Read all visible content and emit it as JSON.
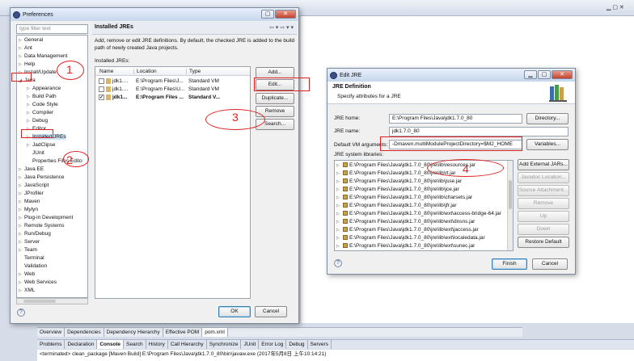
{
  "preferences": {
    "title": "Preferences",
    "filter_placeholder": "type filter text",
    "tree": {
      "general": "General",
      "ant": "Ant",
      "data_management": "Data Management",
      "help": "Help",
      "install_update": "Install/Update",
      "java": "Java",
      "appearance": "Appearance",
      "build_path": "Build Path",
      "code_style": "Code Style",
      "compiler": "Compiler",
      "debug": "Debug",
      "editor": "Editor",
      "installed_jres": "Installed JREs",
      "jadclipse": "JadClipse",
      "junit": "JUnit",
      "properties_files_editor": "Properties Files Edito",
      "java_ee": "Java EE",
      "java_persistence": "Java Persistence",
      "javascript": "JavaScript",
      "jprofiler": "JProfiler",
      "maven": "Maven",
      "mylyn": "Mylyn",
      "plugin_development": "Plug-in Development",
      "remote_systems": "Remote Systems",
      "run_debug": "Run/Debug",
      "server": "Server",
      "team": "Team",
      "terminal": "Terminal",
      "validation": "Validation",
      "web": "Web",
      "web_services": "Web Services",
      "xml": "XML"
    },
    "page_title": "Installed JREs",
    "description": "Add, remove or edit JRE definitions. By default, the checked JRE is added to the build path of newly created Java projects.",
    "list_label": "Installed JREs:",
    "columns": {
      "name": "Name",
      "location": "Location",
      "type": "Type"
    },
    "rows": [
      {
        "name": "jdk1....",
        "location": "E:\\Program Files\\J...",
        "type": "Standard VM",
        "checked": false,
        "bold": false
      },
      {
        "name": "jdk1....",
        "location": "E:\\Program Files\\U...",
        "type": "Standard VM",
        "checked": false,
        "bold": false
      },
      {
        "name": "jdk1...",
        "location": "E:\\Program Files ...",
        "type": "Standard V...",
        "checked": true,
        "bold": true
      }
    ],
    "buttons": {
      "add": "Add...",
      "edit": "Edit...",
      "duplicate": "Duplicate...",
      "remove": "Remove",
      "search": "Search...",
      "ok": "OK",
      "cancel": "Cancel"
    }
  },
  "edit_jre": {
    "title": "Edit JRE",
    "heading": "JRE Definition",
    "subheading": "Specify attributes for a JRE",
    "jre_home_label": "JRE home:",
    "jre_home_value": "E:\\Program Files\\Java\\jdk1.7.0_80",
    "jre_name_label": "JRE name:",
    "jre_name_value": "jdk1.7.0_80",
    "vm_args_label": "Default VM arguments:",
    "vm_args_value": "-Dmaven.multiModuleProjectDirectory=$M2_HOME",
    "libs_label": "JRE system libraries:",
    "libraries": [
      "E:\\Program Files\\Java\\jdk1.7.0_80\\jre\\lib\\resources.jar",
      "E:\\Program Files\\Java\\jdk1.7.0_80\\jre\\lib\\rt.jar",
      "E:\\Program Files\\Java\\jdk1.7.0_80\\jre\\lib\\jsse.jar",
      "E:\\Program Files\\Java\\jdk1.7.0_80\\jre\\lib\\jce.jar",
      "E:\\Program Files\\Java\\jdk1.7.0_80\\jre\\lib\\charsets.jar",
      "E:\\Program Files\\Java\\jdk1.7.0_80\\jre\\lib\\jfr.jar",
      "E:\\Program Files\\Java\\jdk1.7.0_80\\jre\\lib\\ext\\access-bridge-64.jar",
      "E:\\Program Files\\Java\\jdk1.7.0_80\\jre\\lib\\ext\\dnsns.jar",
      "E:\\Program Files\\Java\\jdk1.7.0_80\\jre\\lib\\ext\\jaccess.jar",
      "E:\\Program Files\\Java\\jdk1.7.0_80\\jre\\lib\\ext\\localedata.jar",
      "E:\\Program Files\\Java\\jdk1.7.0_80\\jre\\lib\\ext\\sunec.jar"
    ],
    "buttons": {
      "directory": "Directory...",
      "variables": "Variables...",
      "add_external_jars": "Add External JARs...",
      "javadoc_location": "Javadoc Location...",
      "source_attachment": "Source Attachment...",
      "remove": "Remove",
      "up": "Up",
      "down": "Down",
      "restore_default": "Restore Default",
      "finish": "Finish",
      "cancel": "Cancel"
    }
  },
  "annotations": [
    "1",
    "2",
    "3",
    "4"
  ],
  "bottom_tabs": [
    "Overview",
    "Dependencies",
    "Dependency Hierarchy",
    "Effective POM",
    "pom.xml"
  ],
  "console_tabs": [
    "Problems",
    "Declaration",
    "Console",
    "Search",
    "History",
    "Call Hierarchy",
    "Synchronize",
    "JUnit",
    "Error Log",
    "Debug",
    "Servers"
  ],
  "console_line": "<terminated> clean_package [Maven Build] E:\\Program Files\\Java\\jdk1.7.0_80\\bin\\javaw.exe (2017年5月8日 上午10:14:21)",
  "colors": {
    "annotation": "#e02020",
    "title_gradient_top": "#e8f0fb",
    "selection": "#cde4f7"
  }
}
